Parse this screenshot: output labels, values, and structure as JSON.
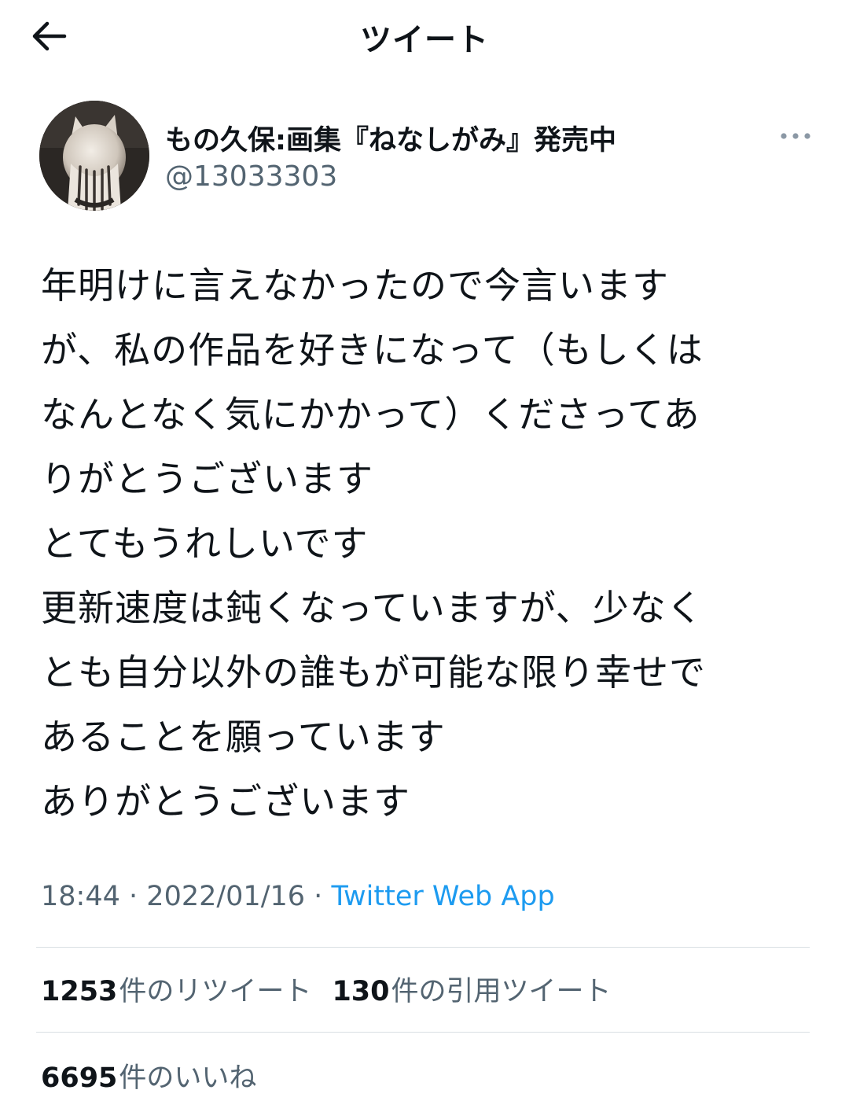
{
  "header": {
    "title": "ツイート",
    "back_icon": "back-arrow-icon"
  },
  "author": {
    "display_name": "もの久保:画集『ねなしがみ』発売中",
    "handle": "@13033303",
    "more_icon": "more-options-icon"
  },
  "tweet": {
    "text": "年明けに言えなかったので今言います\nが、私の作品を好きになって（もしくは\nなんとなく気にかかって）くださってあ\nりがとうございます\nとてもうれしいです\n更新速度は鈍くなっていますが、少なく\nとも自分以外の誰もが可能な限り幸せで\nあることを願っています\nありがとうございます",
    "time": "18:44",
    "date": "2022/01/16",
    "separator": "·",
    "source": "Twitter Web App"
  },
  "stats": {
    "retweets": {
      "count": "1253",
      "label": "件のリツイート"
    },
    "quotes": {
      "count": "130",
      "label": "件の引用ツイート"
    },
    "likes": {
      "count": "6695",
      "label": "件のいいね"
    }
  },
  "colors": {
    "text": "#0f1419",
    "secondary": "#536471",
    "link": "#1d9bf0",
    "divider": "#d9dfe3"
  }
}
